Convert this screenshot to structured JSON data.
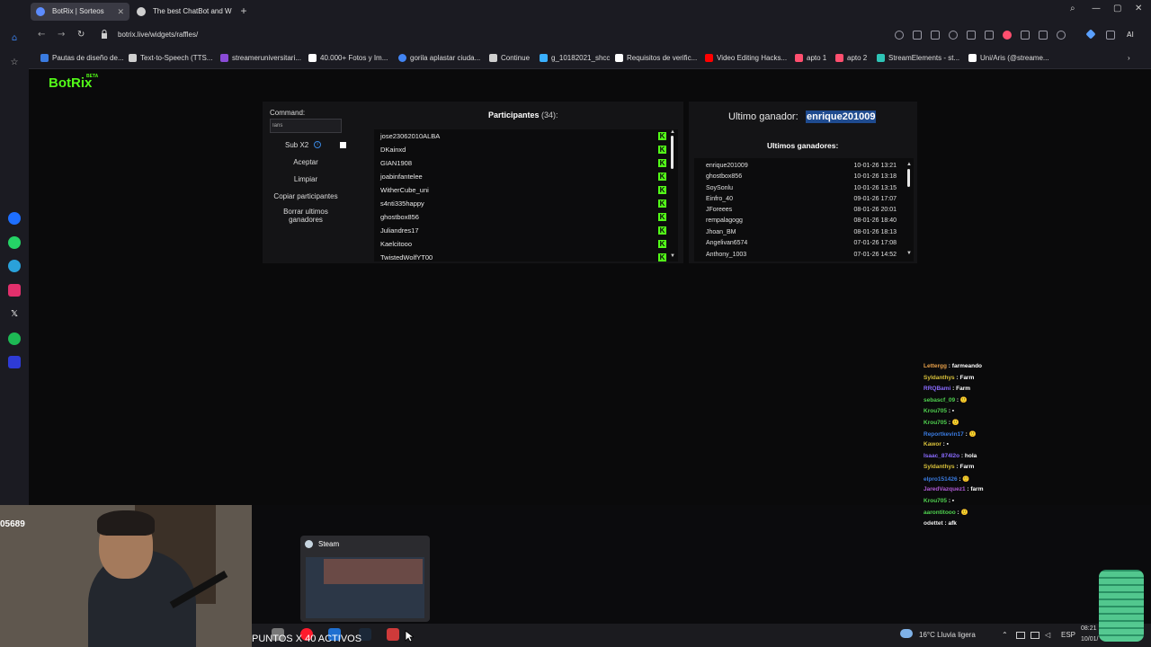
{
  "browser": {
    "tabs": [
      {
        "label": "BotRix | Sorteos"
      },
      {
        "label": "The best ChatBot and Wi"
      }
    ],
    "url": "botrix.live/widgets/raffles/",
    "bookmarks": [
      "Pautas de diseño de...",
      "Text-to-Speech (TTS...",
      "streameruniversitari...",
      "40.000+ Fotos y Im...",
      "gorila aplastar ciuda...",
      "Continue",
      "g_10182021_shcc",
      "Requisitos de verific...",
      "Video Editing Hacks...",
      "apto 1",
      "apto 2",
      "StreamElements - st...",
      "Uni/Aris (@streame..."
    ],
    "bookmark_colors": [
      "#3a7be0",
      "#cfcfcf",
      "#8a4bd6",
      "#ffffff",
      "#4285f4",
      "#cfcfcf",
      "#3ab0ff",
      "#ffffff",
      "#ff0000",
      "#ff4f6f",
      "#ff4f6f",
      "#2ec4b6",
      "#ffffff"
    ],
    "ai_label": "AI"
  },
  "app": {
    "logo": "BotRix",
    "logo_tag": "BETA",
    "accent_color": "#53fc18",
    "command_label": "Command:",
    "command_value": "Iaris",
    "sub_label": "Sub X2",
    "buttons": {
      "accept": "Aceptar",
      "clear": "Limpiar",
      "copy": "Copiar participantes",
      "delete_line1": "Borrar ultimos",
      "delete_line2": "ganadores"
    },
    "participants_title": "Participantes",
    "participants_count": "(34):",
    "participants": [
      "jose23062010ALBA",
      "DKainxd",
      "GIAN1908",
      "joabinfantelee",
      "WitherCube_uni",
      "s4nti335happy",
      "ghostbox856",
      "Juliandres17",
      "Kaelcitooo",
      "TwistedWolfYT00"
    ],
    "winner_label": "Ultimo ganador:",
    "winner_name": "enrique201009",
    "last_winners_title": "Ultimos ganadores:",
    "last_winners": [
      {
        "name": "enrique201009",
        "date": "10-01-26 13:21"
      },
      {
        "name": "ghostbox856",
        "date": "10-01-26 13:18"
      },
      {
        "name": "SoySonlu",
        "date": "10-01-26 13:15"
      },
      {
        "name": "Einfro_40",
        "date": "09-01-26 17:07"
      },
      {
        "name": "JForeees",
        "date": "08-01-26 20:01"
      },
      {
        "name": "rempalagogg",
        "date": "08-01-26 18:40"
      },
      {
        "name": "Jhoan_BM",
        "date": "08-01-26 18:13"
      },
      {
        "name": "Angelivan6574",
        "date": "07-01-26 17:08"
      },
      {
        "name": "Anthony_1003",
        "date": "07-01-26 14:52"
      }
    ]
  },
  "chat": [
    {
      "user": "Lettergg",
      "msg": "farmeando",
      "color": "#e8a04a"
    },
    {
      "user": "Syldanthys",
      "msg": "Farm",
      "color": "#d8c03a"
    },
    {
      "user": "RRQBami",
      "msg": "Farm",
      "color": "#8a6bff"
    },
    {
      "user": "sebascf_09",
      "msg": "🙂",
      "color": "#4fd14f"
    },
    {
      "user": "Krou705",
      "msg": "▪",
      "color": "#4fd14f"
    },
    {
      "user": "Krou705",
      "msg": "🙂",
      "color": "#4fd14f"
    },
    {
      "user": "Reportkevin17",
      "msg": "🙂",
      "color": "#3a7be0"
    },
    {
      "user": "Kawor",
      "msg": "▪",
      "color": "#d8c03a"
    },
    {
      "user": "Isaac_874l2o",
      "msg": "hola",
      "color": "#8a6bff"
    },
    {
      "user": "Syldanthys",
      "msg": "Farm",
      "color": "#d8c03a"
    },
    {
      "user": "elpro151426",
      "msg": "🙂",
      "color": "#3a7be0"
    },
    {
      "user": "JaredVazquez1",
      "msg": "farm",
      "color": "#b05bd6"
    },
    {
      "user": "Krou705",
      "msg": "▪",
      "color": "#4fd14f"
    },
    {
      "user": "aarontitooo",
      "msg": "🙂",
      "color": "#4fd14f"
    },
    {
      "user": "odettet",
      "msg": "afk",
      "color": "#e8e8e8"
    }
  ],
  "overlay": {
    "cam_number": "05689",
    "points_text": "PUNTOS X 40 ACTIVOS",
    "steam_label": "Steam"
  },
  "taskbar": {
    "weather": "16°C  Lluvia ligera",
    "lang": "ESP",
    "time": "08:21",
    "date": "10/01/"
  }
}
